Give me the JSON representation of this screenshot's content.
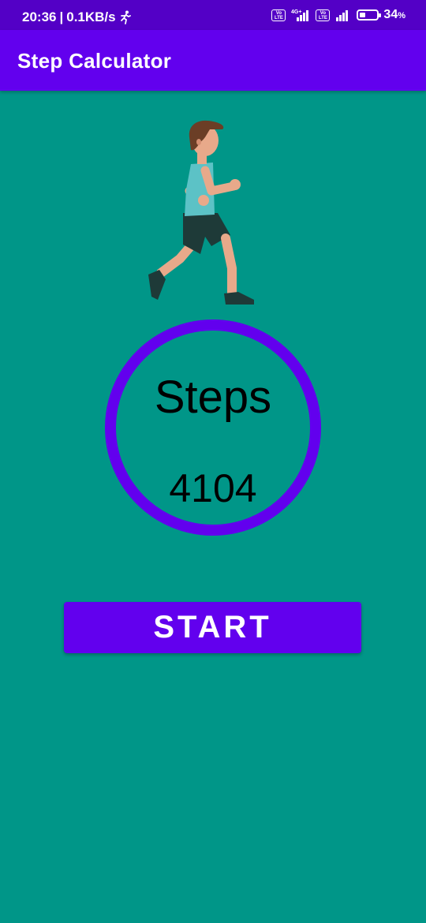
{
  "status_bar": {
    "time": "20:36",
    "separator": "|",
    "data_speed": "0.1KB/s",
    "network_type": "4G+",
    "volte_label": "Vo LTE",
    "battery_level": "34",
    "battery_unit": "%",
    "battery_fraction": 0.34
  },
  "app_bar": {
    "title": "Step Calculator"
  },
  "counter": {
    "label": "Steps",
    "value": "4104"
  },
  "actions": {
    "start_label": "START"
  },
  "colors": {
    "background": "#009688",
    "status_bar": "#5300c6",
    "primary": "#6200ee",
    "text": "#000000"
  },
  "icons": {
    "activity": "running-person-icon",
    "illustration": "runner-illustration"
  }
}
